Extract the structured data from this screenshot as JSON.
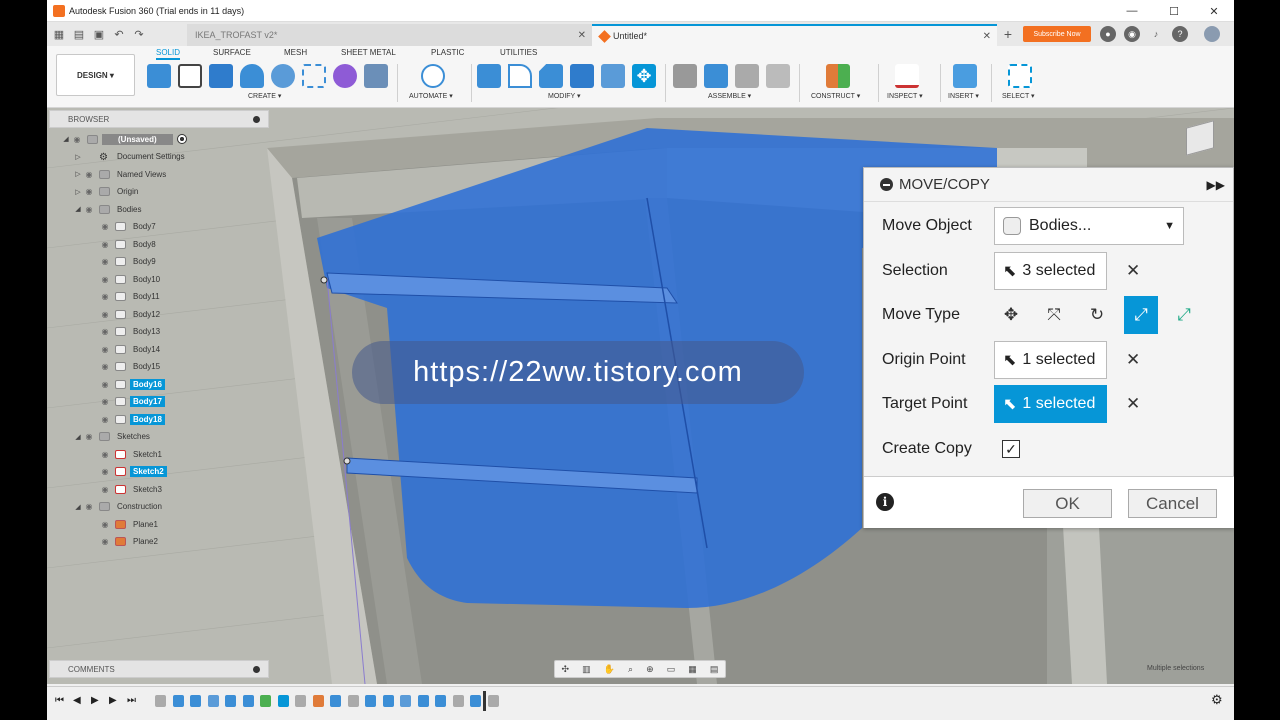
{
  "window": {
    "title": "Autodesk Fusion 360 (Trial ends in 11 days)",
    "min": "—",
    "max": "☐",
    "close": "✕"
  },
  "tabs": [
    {
      "label": "IKEA_TROFAST v2*",
      "close": "✕"
    },
    {
      "label": "Untitled*",
      "close": "✕"
    }
  ],
  "subscribe_label": "Subscribe Now",
  "design_label": "DESIGN ▾",
  "workspace_tabs": [
    "SOLID",
    "SURFACE",
    "MESH",
    "SHEET METAL",
    "PLASTIC",
    "UTILITIES"
  ],
  "toolbar_groups": [
    "CREATE ▾",
    "AUTOMATE ▾",
    "MODIFY ▾",
    "ASSEMBLE ▾",
    "CONSTRUCT ▾",
    "INSPECT ▾",
    "INSERT ▾",
    "SELECT ▾"
  ],
  "browser": {
    "title": "BROWSER",
    "rows": [
      {
        "label": "(Unsaved)",
        "level": 0,
        "kind": "root"
      },
      {
        "label": "Document Settings",
        "level": 1,
        "kind": "gear"
      },
      {
        "label": "Named Views",
        "level": 1,
        "kind": "folder"
      },
      {
        "label": "Origin",
        "level": 1,
        "kind": "folder"
      },
      {
        "label": "Bodies",
        "level": 1,
        "kind": "folder"
      },
      {
        "label": "Body7",
        "level": 2,
        "kind": "body"
      },
      {
        "label": "Body8",
        "level": 2,
        "kind": "body"
      },
      {
        "label": "Body9",
        "level": 2,
        "kind": "body"
      },
      {
        "label": "Body10",
        "level": 2,
        "kind": "body"
      },
      {
        "label": "Body11",
        "level": 2,
        "kind": "body"
      },
      {
        "label": "Body12",
        "level": 2,
        "kind": "body"
      },
      {
        "label": "Body13",
        "level": 2,
        "kind": "body"
      },
      {
        "label": "Body14",
        "level": 2,
        "kind": "body"
      },
      {
        "label": "Body15",
        "level": 2,
        "kind": "body"
      },
      {
        "label": "Body16",
        "level": 2,
        "kind": "body",
        "selected": true
      },
      {
        "label": "Body17",
        "level": 2,
        "kind": "body",
        "selected": true
      },
      {
        "label": "Body18",
        "level": 2,
        "kind": "body",
        "selected": true
      },
      {
        "label": "Sketches",
        "level": 1,
        "kind": "folder"
      },
      {
        "label": "Sketch1",
        "level": 2,
        "kind": "sketch"
      },
      {
        "label": "Sketch2",
        "level": 2,
        "kind": "sketch",
        "selected": true
      },
      {
        "label": "Sketch3",
        "level": 2,
        "kind": "sketch"
      },
      {
        "label": "Construction",
        "level": 1,
        "kind": "folder"
      },
      {
        "label": "Plane1",
        "level": 2,
        "kind": "plane"
      },
      {
        "label": "Plane2",
        "level": 2,
        "kind": "plane"
      }
    ]
  },
  "comments_label": "COMMENTS",
  "status_text": "Multiple selections",
  "watermark": "https://22ww.tistory.com",
  "dialog": {
    "title": "MOVE/COPY",
    "move_object_label": "Move Object",
    "move_object_value": "Bodies...",
    "selection_label": "Selection",
    "selection_value": "3 selected",
    "move_type_label": "Move Type",
    "origin_label": "Origin Point",
    "origin_value": "1 selected",
    "target_label": "Target Point",
    "target_value": "1 selected",
    "create_copy_label": "Create Copy",
    "create_copy_checked": true,
    "ok": "OK",
    "cancel": "Cancel"
  },
  "colors": {
    "accent": "#0696d7",
    "body_blue": "#2e6fd6",
    "orange": "#f37021"
  }
}
